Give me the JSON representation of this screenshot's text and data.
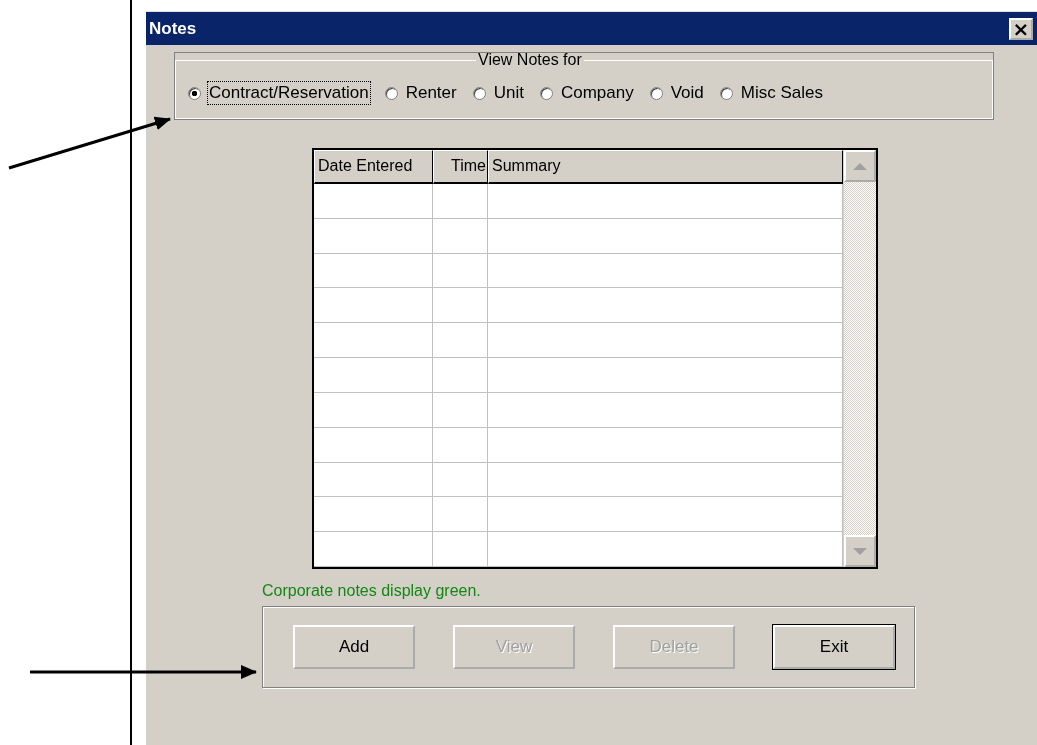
{
  "window": {
    "title": "Notes",
    "close_label": "×"
  },
  "view_notes_for": {
    "legend": "View Notes for",
    "options": [
      {
        "label": "Contract/Reservation",
        "selected": true,
        "focused": true
      },
      {
        "label": "Renter",
        "selected": false,
        "focused": false
      },
      {
        "label": "Unit",
        "selected": false,
        "focused": false
      },
      {
        "label": "Company",
        "selected": false,
        "focused": false
      },
      {
        "label": "Void",
        "selected": false,
        "focused": false
      },
      {
        "label": "Misc Sales",
        "selected": false,
        "focused": false
      }
    ]
  },
  "table": {
    "columns": [
      "Date Entered",
      "Time",
      "Summary"
    ]
  },
  "note": "Corporate notes display green.",
  "buttons": [
    {
      "label": "Add",
      "disabled": false,
      "default": false
    },
    {
      "label": "View",
      "disabled": true,
      "default": false
    },
    {
      "label": "Delete",
      "disabled": true,
      "default": false
    },
    {
      "label": "Exit",
      "disabled": false,
      "default": true
    }
  ]
}
